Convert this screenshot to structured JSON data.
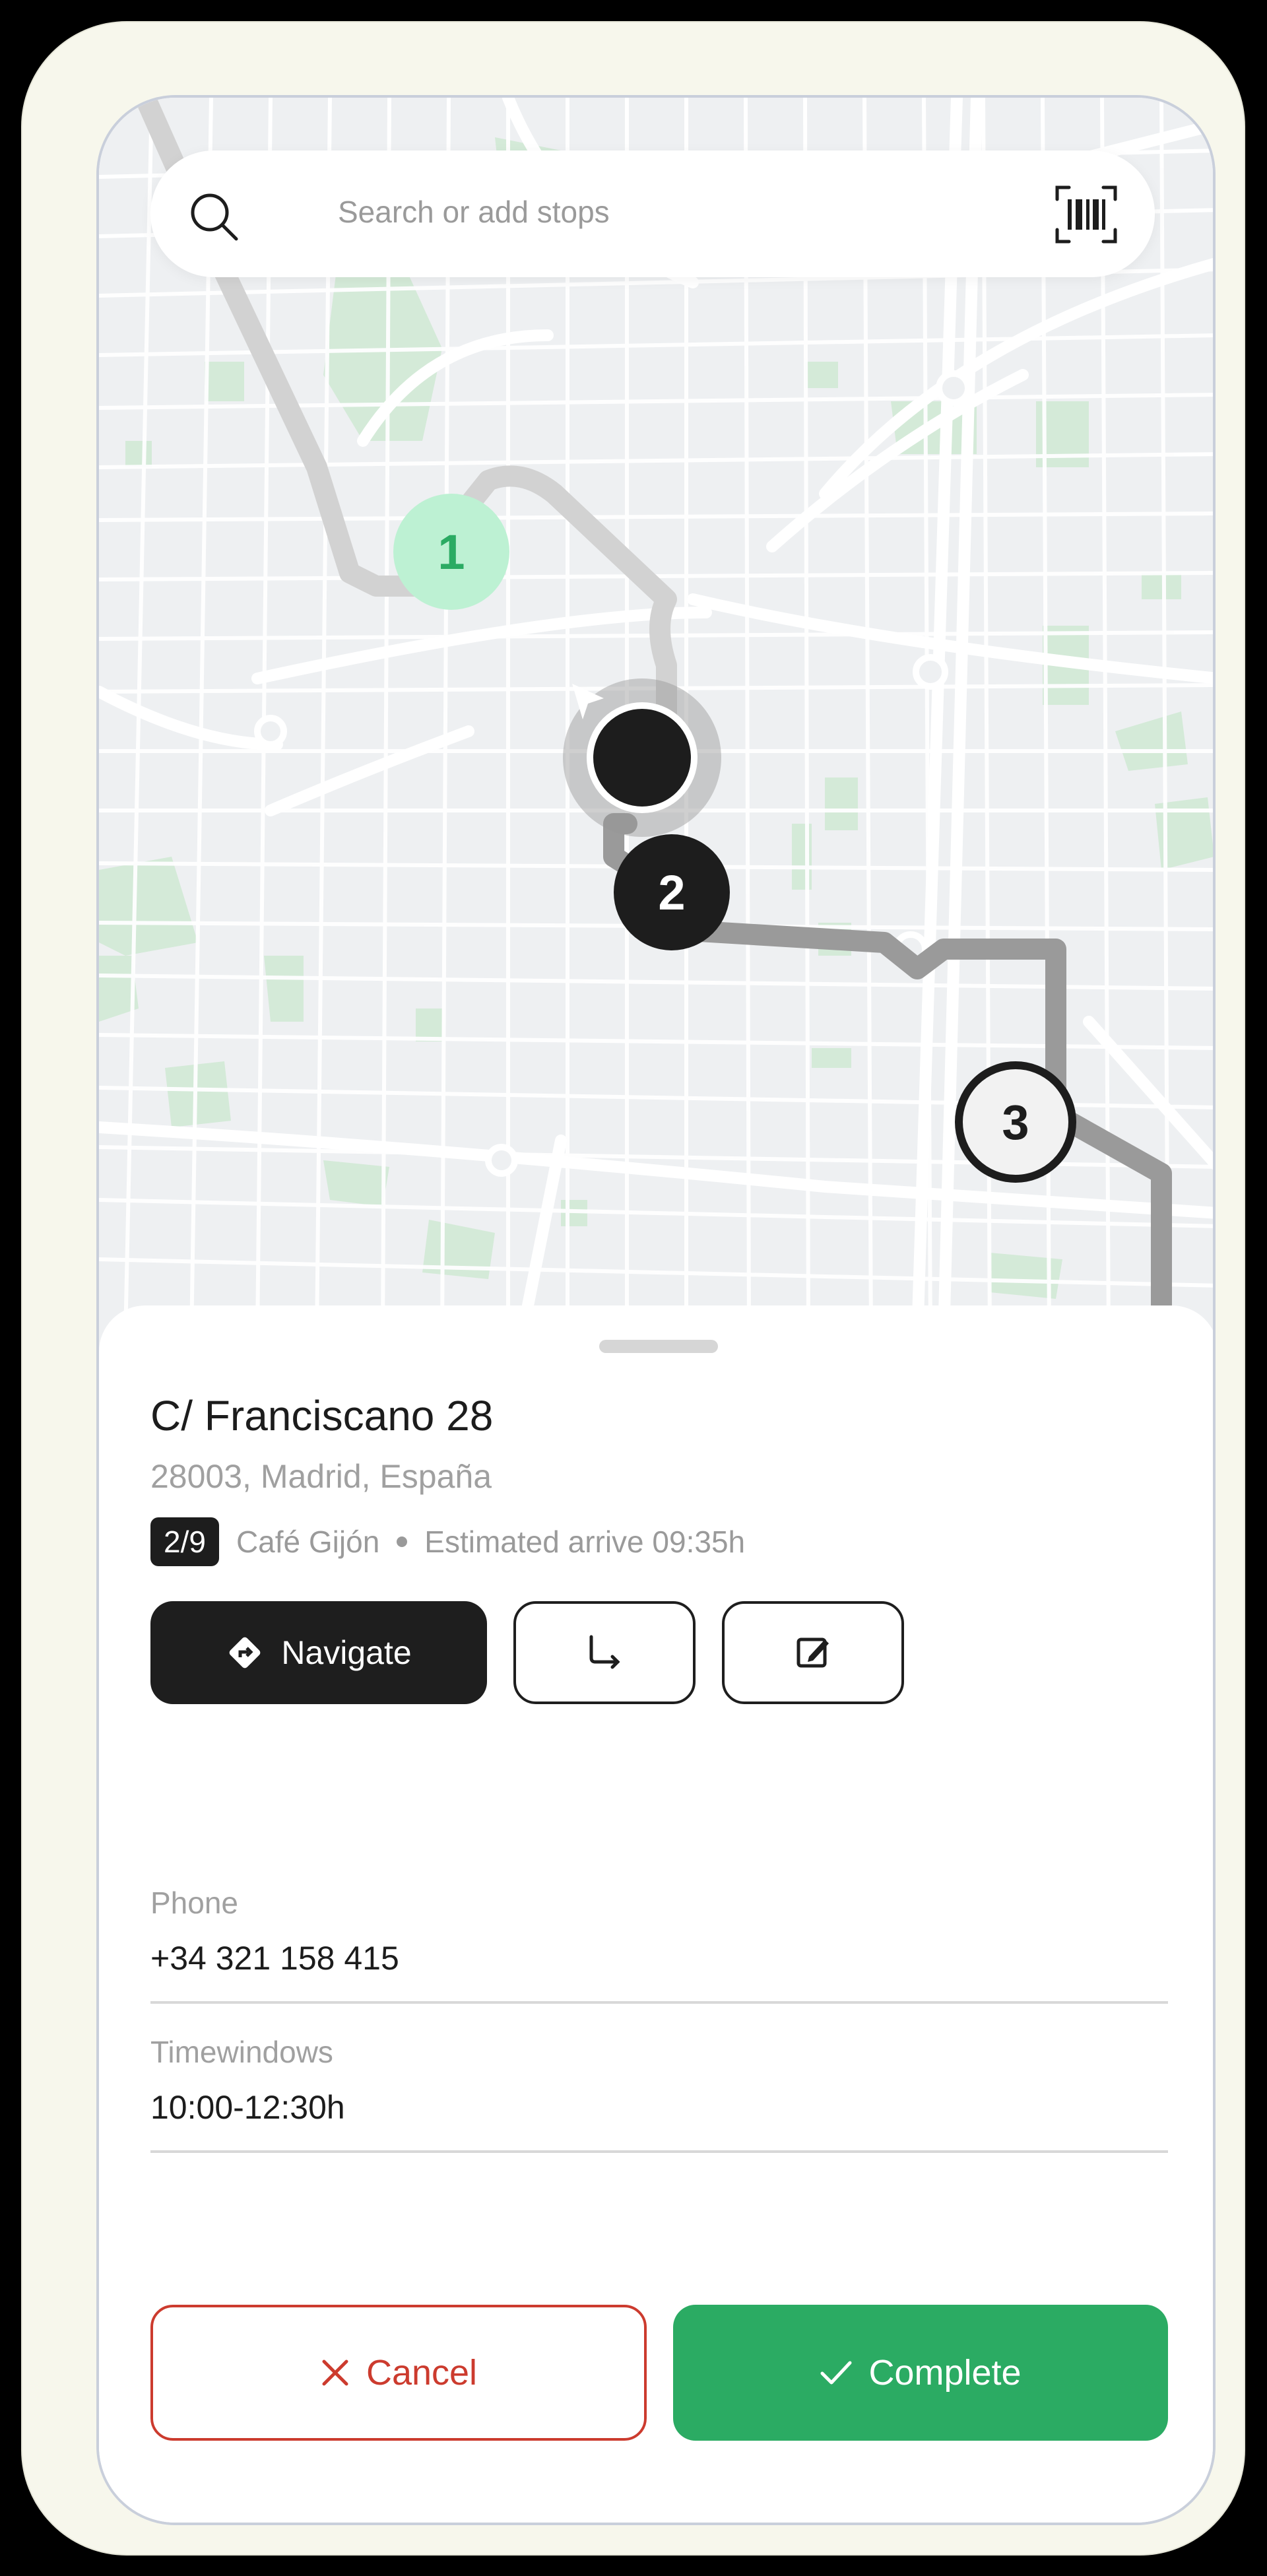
{
  "search": {
    "placeholder": "Search or add stops"
  },
  "map": {
    "stops": [
      {
        "label": "1",
        "state": "completed"
      },
      {
        "label": "2",
        "state": "current"
      },
      {
        "label": "3",
        "state": "upcoming"
      }
    ]
  },
  "stop_detail": {
    "address_line1": "C/ Franciscano 28",
    "address_line2": "28003, Madrid, España",
    "stop_counter": "2/9",
    "place_name": "Café Gijón",
    "eta_text": "Estimated arrive 09:35h",
    "navigate_label": "Navigate"
  },
  "fields": [
    {
      "label": "Phone",
      "value": "+34 321 158 415"
    },
    {
      "label": "Timewindows",
      "value": "10:00-12:30h"
    }
  ],
  "footer": {
    "cancel_label": "Cancel",
    "complete_label": "Complete"
  },
  "colors": {
    "accent_green": "#2bab63",
    "cancel_red": "#cc3b2e",
    "completed_stop": "#bdf1d3",
    "dark": "#1e1e1e"
  },
  "icons": [
    "search-icon",
    "barcode-icon",
    "navigation-arrow-icon",
    "navigate-diamond-icon",
    "reroute-arrow-icon",
    "edit-note-icon",
    "close-x-icon",
    "checkmark-icon"
  ]
}
